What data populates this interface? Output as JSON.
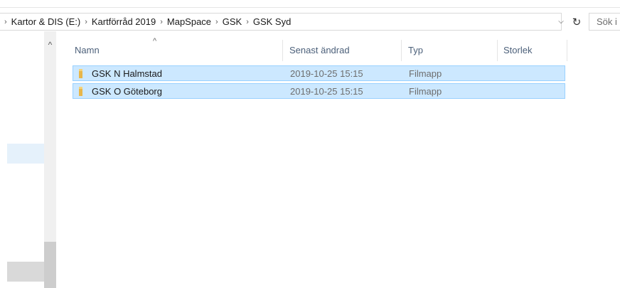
{
  "address_bar": {
    "crumbs": [
      "Kartor & DIS (E:)",
      "Kartförråd 2019",
      "MapSpace",
      "GSK",
      "GSK Syd"
    ],
    "separator": "›",
    "leading_separator": "›"
  },
  "controls": {
    "dropdown_icon": "chevron-down-icon",
    "dropdown_glyph": "⌵",
    "refresh_icon": "refresh-icon",
    "refresh_glyph": "↻",
    "search_placeholder": "Sök i"
  },
  "columns": {
    "name": "Namn",
    "modified": "Senast ändrad",
    "type": "Typ",
    "size": "Storlek",
    "sort_indicator": "^"
  },
  "scrollbar": {
    "up_glyph": "^"
  },
  "files": [
    {
      "name": "GSK N Halmstad",
      "modified": "2019-10-25 15:15",
      "type": "Filmapp",
      "size": "",
      "icon": "folder-icon",
      "selected": true
    },
    {
      "name": "GSK O Göteborg",
      "modified": "2019-10-25 15:15",
      "type": "Filmapp",
      "size": "",
      "icon": "folder-icon",
      "selected": true
    }
  ],
  "colors": {
    "selection_fill": "#cce8ff",
    "selection_border": "#99d1ff",
    "folder": "#e8b64a",
    "header_text": "#4c607a"
  }
}
